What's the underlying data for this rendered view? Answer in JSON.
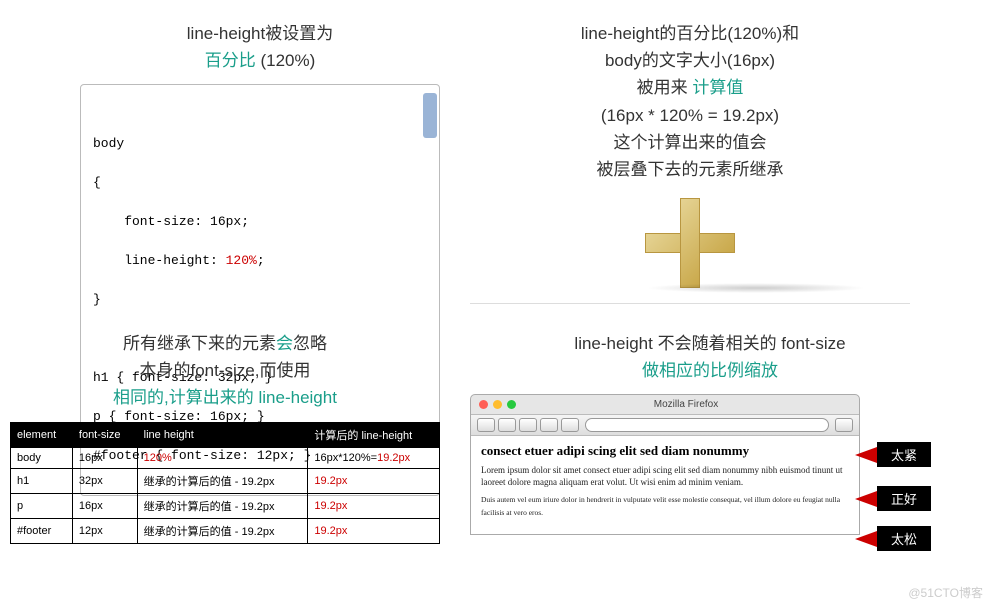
{
  "q1": {
    "heading_1": "line-height被设置为",
    "heading_2a": "百分比",
    "heading_2b": " (120%)",
    "code": {
      "l1": "body",
      "l2": "{",
      "l3": "    font-size: 16px;",
      "l4a": "    line-height: ",
      "l4b": "120%",
      "l4c": ";",
      "l5": "}",
      "l6": "",
      "l7": "h1 { font-size: 32px; }",
      "l8": "p { font-size: 16px; }",
      "l9": "#footer { font-size: 12px; }"
    }
  },
  "q2": {
    "l1": "line-height的百分比(120%)和",
    "l2": "body的文字大小(16px)",
    "l3a": "被用来 ",
    "l3b": "计算值",
    "l4": "(16px * 120% = 19.2px)",
    "l5": "这个计算出来的值会",
    "l6": "被层叠下去的元素所继承"
  },
  "q3": {
    "l1a": "所有继承下来的元素",
    "l1b": "会",
    "l1c": "忽略",
    "l2": "本身的font-size,而使用",
    "l3": "相同的,计算出来的 line-height",
    "headers": [
      "element",
      "font-size",
      "line height",
      "计算后的 line-height"
    ],
    "rows": [
      {
        "el": "body",
        "fs": "16px",
        "lh": "120%",
        "calc_a": "16px*120%=",
        "calc_b": "19.2px"
      },
      {
        "el": "h1",
        "fs": "32px",
        "lh": "继承的计算后的值 - 19.2px",
        "calc": "19.2px"
      },
      {
        "el": "p",
        "fs": "16px",
        "lh": "继承的计算后的值 - 19.2px",
        "calc": "19.2px"
      },
      {
        "el": "#footer",
        "fs": "12px",
        "lh": "继承的计算后的值 - 19.2px",
        "calc": "19.2px"
      }
    ]
  },
  "q4": {
    "l1": "line-height 不会随着相关的 font-size",
    "l2": "做相应的比例缩放",
    "browser_title": "Mozilla Firefox",
    "h1": "consect etuer adipi scing elit sed diam nonummy",
    "p": "Lorem ipsum dolor sit amet consect etuer adipi scing elit sed diam nonummy nibh euismod tinunt ut laoreet dolore magna aliquam erat volut. Ut wisi enim ad minim veniam.",
    "footer": "Duis autem vel eum iriure dolor in hendrerit in vulputate velit esse molestie consequat, vel illum dolore eu feugiat nulla facilisis at vero eros.",
    "tags": [
      "太紧",
      "正好",
      "太松"
    ]
  },
  "watermark": "@51CTO博客"
}
